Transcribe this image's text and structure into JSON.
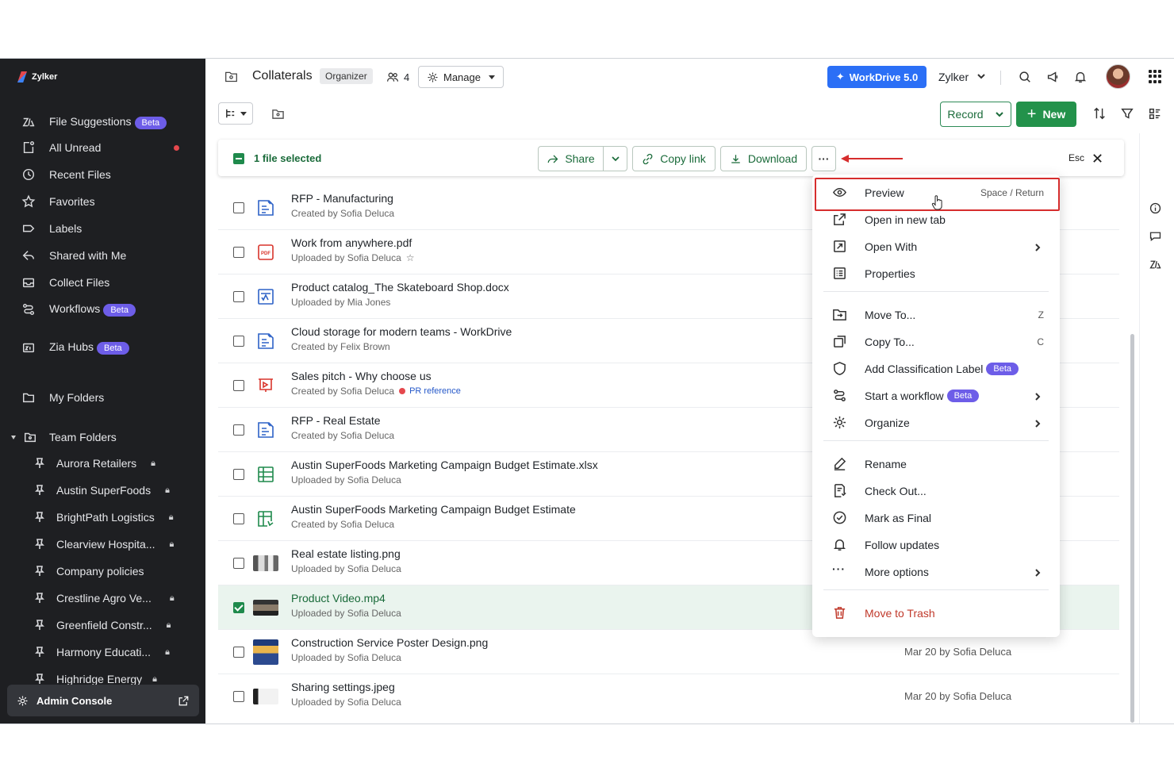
{
  "sidebar": {
    "brand": "Zylker",
    "items": [
      {
        "label": "File Suggestions",
        "badge": "Beta",
        "icon": "zia-icon"
      },
      {
        "label": "All Unread",
        "icon": "unread-icon"
      },
      {
        "label": "Recent Files",
        "icon": "clock-icon"
      },
      {
        "label": "Favorites",
        "icon": "star-icon"
      },
      {
        "label": "Labels",
        "icon": "label-icon"
      },
      {
        "label": "Shared with Me",
        "icon": "share-icon"
      },
      {
        "label": "Collect Files",
        "icon": "inbox-icon"
      },
      {
        "label": "Workflows",
        "badge": "Beta",
        "icon": "workflow-icon"
      },
      {
        "label": "Zia Hubs",
        "badge": "Beta",
        "icon": "hub-icon"
      },
      {
        "label": "My Folders",
        "icon": "folder-icon"
      },
      {
        "label": "Team Folders",
        "icon": "team-folder-icon"
      }
    ],
    "team_folders": [
      {
        "label": "Aurora Retailers"
      },
      {
        "label": "Austin SuperFoods"
      },
      {
        "label": "BrightPath Logistics"
      },
      {
        "label": "Clearview Hospita..."
      },
      {
        "label": "Company policies"
      },
      {
        "label": "Crestline Agro Ve..."
      },
      {
        "label": "Greenfield Constr..."
      },
      {
        "label": "Harmony Educati..."
      },
      {
        "label": "Highridge Energy"
      }
    ],
    "admin": "Admin Console"
  },
  "header": {
    "title": "Collaterals",
    "tag": "Organizer",
    "members": "4",
    "manage": "Manage",
    "workdrive": "WorkDrive 5.0",
    "org": "Zylker"
  },
  "toolbar": {
    "record": "Record",
    "new": "New"
  },
  "selection": {
    "text": "1 file selected",
    "share": "Share",
    "copy_link": "Copy link",
    "download": "Download",
    "more": "···",
    "esc": "Esc"
  },
  "files": [
    {
      "name": "RFP - Manufacturing",
      "sub": "Created by Sofia Deluca",
      "icon": "writer-doc-icon"
    },
    {
      "name": "Work from anywhere.pdf",
      "sub": "Uploaded by Sofia Deluca",
      "icon": "pdf-icon",
      "star": "☆"
    },
    {
      "name": "Product catalog_The Skateboard Shop.docx",
      "sub": "Uploaded by Mia Jones",
      "icon": "docx-icon"
    },
    {
      "name": "Cloud storage for modern teams - WorkDrive",
      "sub": "Created by Felix Brown",
      "icon": "writer-doc-icon"
    },
    {
      "name": "Sales pitch - Why choose us",
      "sub": "Created by Sofia Deluca",
      "icon": "presentation-icon",
      "label": "PR reference"
    },
    {
      "name": "RFP - Real Estate",
      "sub": "Created by Sofia Deluca",
      "icon": "writer-doc-icon"
    },
    {
      "name": "Austin SuperFoods Marketing Campaign Budget Estimate.xlsx",
      "sub": "Uploaded by Sofia Deluca",
      "icon": "spreadsheet-icon"
    },
    {
      "name": "Austin SuperFoods Marketing Campaign Budget Estimate",
      "sub": "Created by Sofia Deluca",
      "icon": "sheet-doc-icon"
    },
    {
      "name": "Real estate listing.png",
      "sub": "Uploaded by Sofia Deluca",
      "icon": "image-thumb"
    },
    {
      "name": "Product Video.mp4",
      "sub": "Uploaded by Sofia Deluca",
      "icon": "video-thumb",
      "selected": true
    },
    {
      "name": "Construction Service Poster Design.png",
      "sub": "Uploaded by Sofia Deluca",
      "icon": "poster-thumb",
      "date": "Mar 20 by Sofia Deluca"
    },
    {
      "name": "Sharing settings.jpeg",
      "sub": "Uploaded by Sofia Deluca",
      "icon": "screenshot-thumb",
      "date": "Mar 20 by Sofia Deluca"
    }
  ],
  "menu": {
    "preview": {
      "label": "Preview",
      "shortcut": "Space / Return"
    },
    "open_new_tab": {
      "label": "Open in new tab"
    },
    "open_with": {
      "label": "Open With"
    },
    "properties": {
      "label": "Properties"
    },
    "move_to": {
      "label": "Move To...",
      "shortcut": "Z"
    },
    "copy_to": {
      "label": "Copy To...",
      "shortcut": "C"
    },
    "classification": {
      "label": "Add Classification Label",
      "badge": "Beta"
    },
    "workflow": {
      "label": "Start a workflow",
      "badge": "Beta"
    },
    "organize": {
      "label": "Organize"
    },
    "rename": {
      "label": "Rename"
    },
    "check_out": {
      "label": "Check Out..."
    },
    "mark_final": {
      "label": "Mark as Final"
    },
    "follow": {
      "label": "Follow updates"
    },
    "more_options": {
      "label": "More options"
    },
    "trash": {
      "label": "Move to Trash"
    }
  },
  "colors": {
    "accent_green": "#23924b",
    "workdrive_blue": "#2b6ff6",
    "beta_purple": "#6d5de8",
    "highlight_red": "#d62d2d"
  }
}
